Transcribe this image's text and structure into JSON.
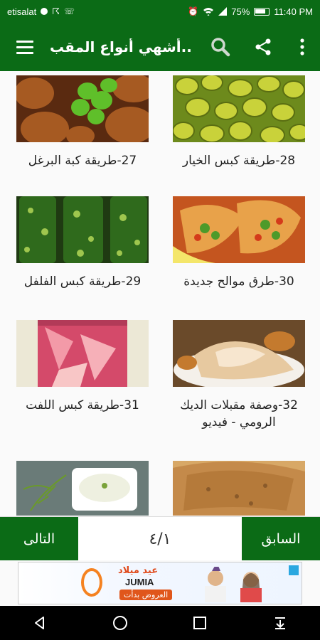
{
  "status_bar": {
    "carrier": "etisalat",
    "battery_percent": "75%",
    "time": "11:40 PM"
  },
  "app_bar": {
    "title": "أشهي أنواع المقب..",
    "icons": [
      "menu-icon",
      "search-icon",
      "share-icon",
      "more-vert-icon"
    ]
  },
  "items": [
    {
      "label": "28-طريقة كبس الخيار",
      "image": "pickled-cucumbers"
    },
    {
      "label": "27-طريقة كبة البرغل",
      "image": "kibbeh"
    },
    {
      "label": "30-طرق موالح جديدة",
      "image": "stuffed-pastry"
    },
    {
      "label": "29-طريقة كبس الفلفل",
      "image": "pickled-peppers-jars"
    },
    {
      "label": "32-وصفة مقبلات الديك الرومي - فيديو",
      "image": "sliced-turkey"
    },
    {
      "label": "31-طريقة كبس اللفت",
      "image": "pickled-turnip-jar"
    },
    {
      "label": "",
      "image": "flatbread"
    },
    {
      "label": "",
      "image": "yogurt-dip"
    }
  ],
  "pager": {
    "next_label": "التالى",
    "prev_label": "السابق",
    "page_indicator": "٤/١"
  },
  "ad": {
    "title": "عيد ميلاد",
    "brand": "JUMIA",
    "cta": "العروض بدأت",
    "logo_number": "6"
  },
  "colors": {
    "primary": "#0b6b16",
    "background": "#fafafa",
    "text": "#222222"
  },
  "nav_bar": {
    "icons": [
      "back-icon",
      "home-icon",
      "recents-icon",
      "notification-pull-icon"
    ]
  }
}
